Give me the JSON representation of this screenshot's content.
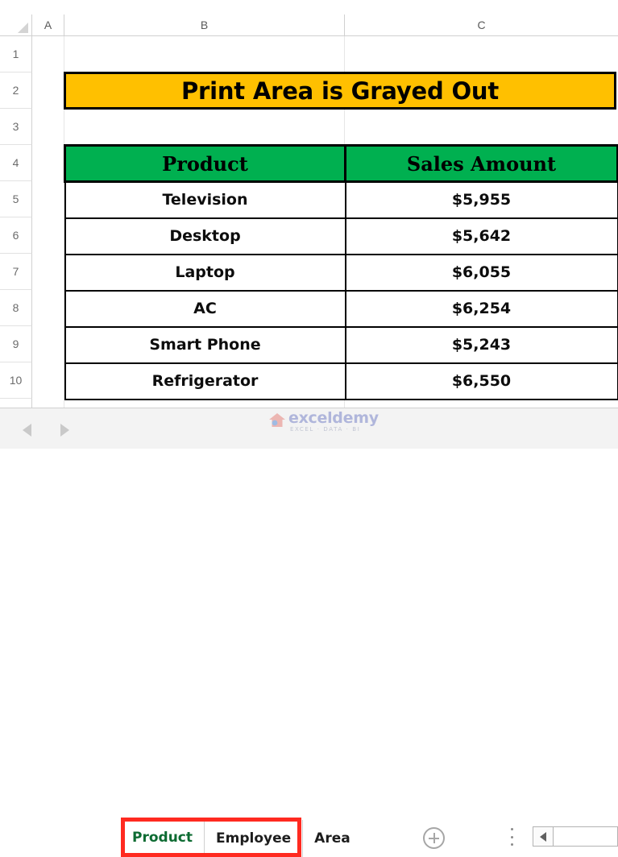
{
  "spreadsheet": {
    "column_headers": [
      "A",
      "B",
      "C"
    ],
    "row_numbers": [
      "1",
      "2",
      "3",
      "4",
      "5",
      "6",
      "7",
      "8",
      "9",
      "10"
    ],
    "title_banner": {
      "text": "Print Area is Grayed Out",
      "fill_color": "#FFC000",
      "border_color": "#000000"
    },
    "table": {
      "header_fill_color": "#00B050",
      "columns": [
        "Product",
        "Sales Amount"
      ],
      "rows": [
        {
          "product": "Television",
          "amount": "$5,955"
        },
        {
          "product": "Desktop",
          "amount": "$5,642"
        },
        {
          "product": "Laptop",
          "amount": "$6,055"
        },
        {
          "product": "AC",
          "amount": "$6,254"
        },
        {
          "product": "Smart Phone",
          "amount": "$5,243"
        },
        {
          "product": "Refrigerator",
          "amount": "$6,550"
        }
      ]
    }
  },
  "tabbar": {
    "nav_prev_icon": "triangle-left-icon",
    "nav_next_icon": "triangle-right-icon",
    "tabs": [
      {
        "label": "Product",
        "active": true
      },
      {
        "label": "Employee",
        "active": false
      },
      {
        "label": "Area",
        "active": false
      }
    ],
    "active_tab_color": "#0D6B32",
    "add_sheet_icon": "plus-circle-icon",
    "overflow_icon": "vertical-dots-icon",
    "scroll_left_icon": "triangle-left-icon",
    "highlight_color": "#FF2A20"
  },
  "watermark": {
    "brand": "exceldemy",
    "tagline": "EXCEL · DATA · BI",
    "logo_icon": "house-logo-icon",
    "color": "#7A86C9"
  }
}
